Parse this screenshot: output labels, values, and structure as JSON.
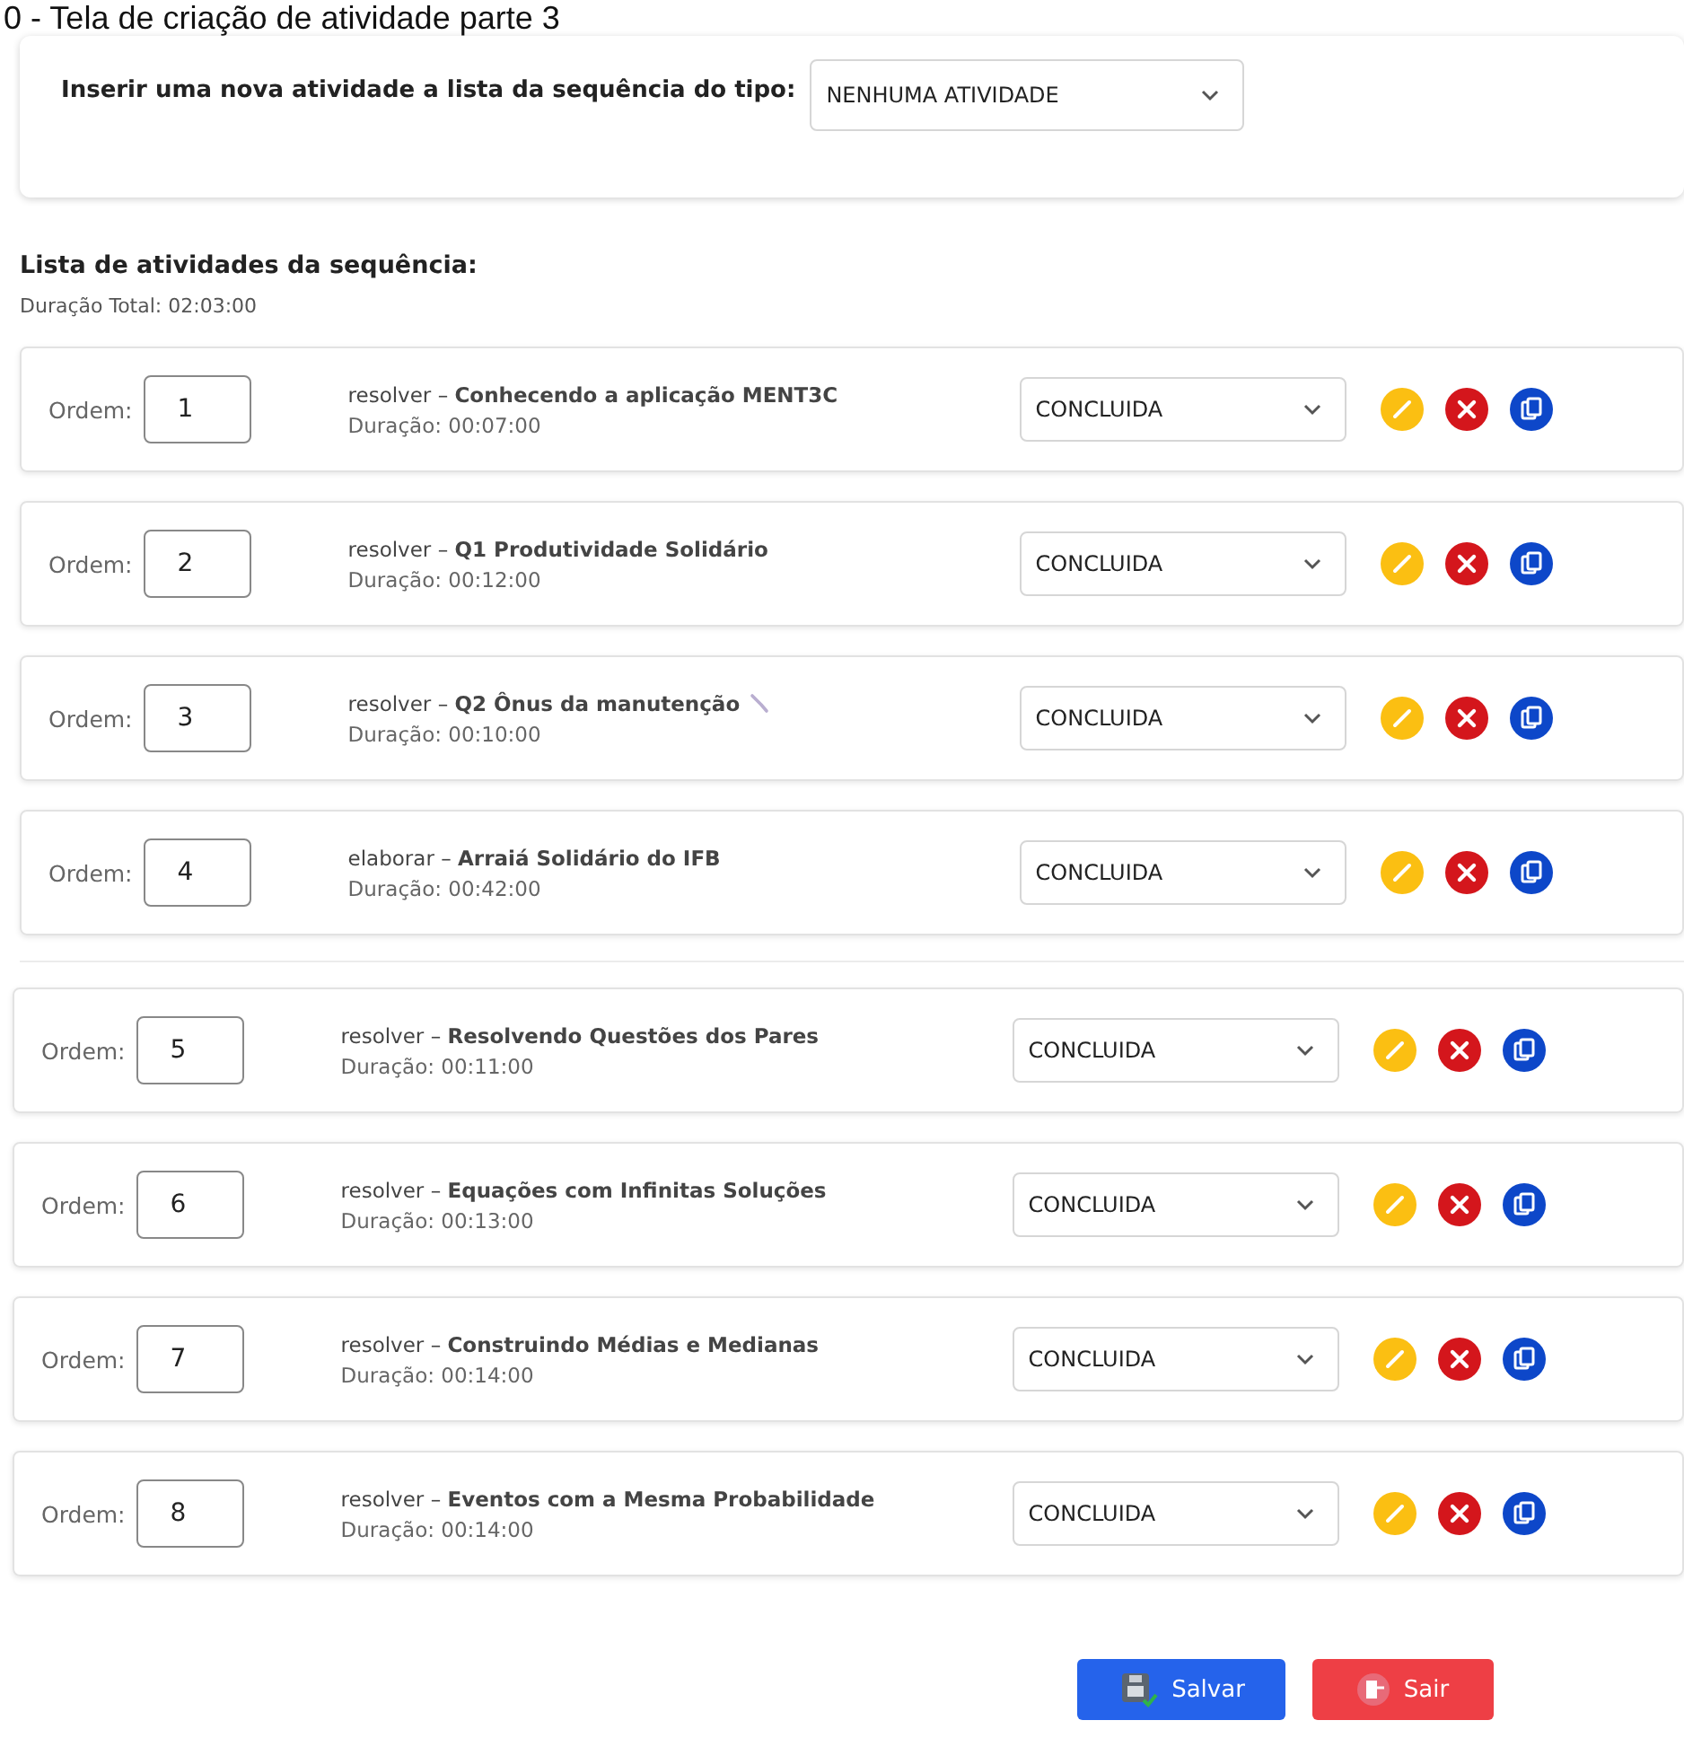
{
  "page_title": "0 - Tela de criação de atividade parte 3",
  "insert": {
    "label": "Inserir uma nova atividade a lista da sequência do tipo:",
    "value": "NENHUMA ATIVIDADE"
  },
  "list": {
    "heading": "Lista de atividades da sequência:",
    "total": "Duração Total: 02:03:00"
  },
  "groups": [
    {
      "activities": [
        {
          "order_label": "Ordem:",
          "order": "1",
          "text": "resolver – **Conhecendo a aplicação MENT3C**",
          "duration": "Duração: 00:07:00",
          "tool_icon": false,
          "status": "CONCLUIDA"
        },
        {
          "order_label": "Ordem:",
          "order": "2",
          "text": "resolver – **Q1 Produtividade Solidário**",
          "duration": "Duração: 00:12:00",
          "tool_icon": false,
          "status": "CONCLUIDA"
        },
        {
          "order_label": "Ordem:",
          "order": "3",
          "text": "resolver – **Q2 Ônus da manutenção**",
          "duration": "Duração: 00:10:00",
          "tool_icon": true,
          "status": "CONCLUIDA"
        },
        {
          "order_label": "Ordem:",
          "order": "4",
          "text": "elaborar – **Arraiá Solidário do IFB**",
          "duration": "Duração: 00:42:00",
          "tool_icon": false,
          "status": "CONCLUIDA"
        }
      ]
    },
    {
      "activities": [
        {
          "order_label": "Ordem:",
          "order": "5",
          "text": "resolver – **Resolvendo Questões dos Pares**",
          "duration": "Duração: 00:11:00",
          "tool_icon": false,
          "status": "CONCLUIDA"
        },
        {
          "order_label": "Ordem:",
          "order": "6",
          "text": "resolver – **Equações com Infinitas Soluções**",
          "duration": "Duração: 00:13:00",
          "tool_icon": false,
          "status": "CONCLUIDA"
        },
        {
          "order_label": "Ordem:",
          "order": "7",
          "text": "resolver – **Construindo Médias e Medianas**",
          "duration": "Duração: 00:14:00",
          "tool_icon": false,
          "status": "CONCLUIDA"
        },
        {
          "order_label": "Ordem:",
          "order": "8",
          "text": "resolver – **Eventos com a Mesma Probabilidade**",
          "duration": "Duração: 00:14:00",
          "tool_icon": false,
          "status": "CONCLUIDA"
        }
      ]
    }
  ],
  "buttons": [
    {
      "kind": "save",
      "label": "Salvar"
    },
    {
      "kind": "exit",
      "label": "Sair"
    }
  ]
}
